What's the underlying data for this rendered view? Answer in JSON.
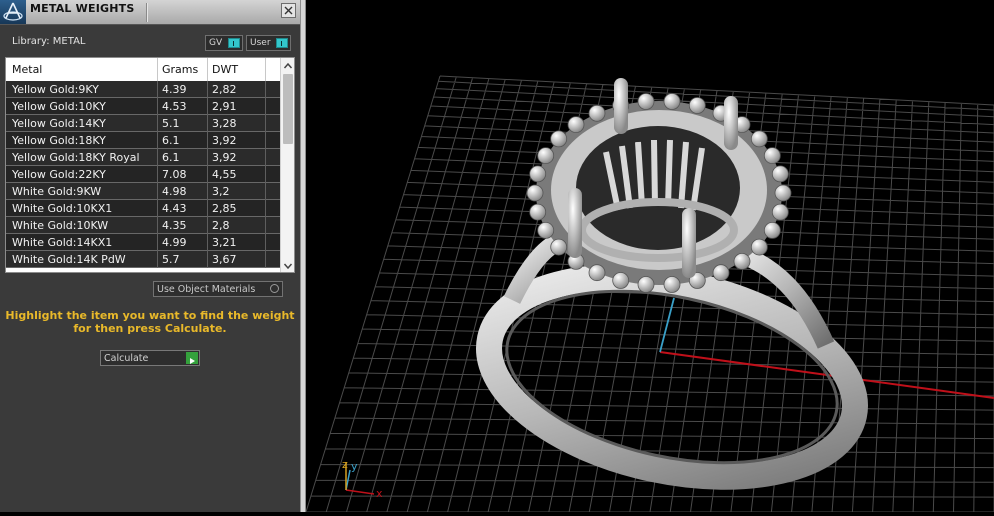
{
  "panel": {
    "title": "METAL WEIGHTS",
    "library_label": "Library: METAL",
    "toggle_gv": "GV",
    "toggle_user": "User",
    "columns": [
      "Metal",
      "Grams",
      "DWT"
    ],
    "rows": [
      {
        "metal": "Yellow Gold:9KY",
        "grams": "4.39",
        "dwt": "2,82"
      },
      {
        "metal": "Yellow Gold:10KY",
        "grams": "4.53",
        "dwt": "2,91"
      },
      {
        "metal": "Yellow Gold:14KY",
        "grams": "5.1",
        "dwt": "3,28"
      },
      {
        "metal": "Yellow Gold:18KY",
        "grams": "6.1",
        "dwt": "3,92"
      },
      {
        "metal": "Yellow Gold:18KY Royal",
        "grams": "6.1",
        "dwt": "3,92"
      },
      {
        "metal": "Yellow Gold:22KY",
        "grams": "7.08",
        "dwt": "4,55"
      },
      {
        "metal": "White Gold:9KW",
        "grams": "4.98",
        "dwt": "3,2"
      },
      {
        "metal": "White Gold:10KX1",
        "grams": "4.43",
        "dwt": "2,85"
      },
      {
        "metal": "White Gold:10KW",
        "grams": "4.35",
        "dwt": "2,8"
      },
      {
        "metal": "White Gold:14KX1",
        "grams": "4.99",
        "dwt": "3,21"
      },
      {
        "metal": "White Gold:14K PdW",
        "grams": "5.7",
        "dwt": "3,67"
      }
    ],
    "use_object_materials": "Use Object Materials",
    "hint_line1": "Highlight the item you want to find the weight",
    "hint_line2": "for then press Calculate.",
    "calculate_label": "Calculate",
    "hint_color": "#e9b92a"
  },
  "viewport": {
    "axis_x_label": "x",
    "axis_y_label": "y",
    "axis_z_label": "z",
    "grid_color": "#4a4a4a",
    "x_axis_color": "#c0101a",
    "y_axis_color": "#3aa0c8"
  }
}
